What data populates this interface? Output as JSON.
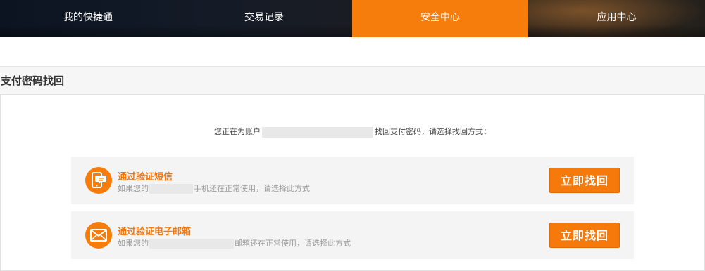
{
  "nav": {
    "tabs": [
      {
        "label": "我的快捷通"
      },
      {
        "label": "交易记录"
      },
      {
        "label": "安全中心",
        "active": true
      },
      {
        "label": "应用中心"
      }
    ]
  },
  "section": {
    "title": "支付密码找回"
  },
  "prompt": {
    "prefix": "您正在为账户",
    "suffix": "找回支付密码，请选择找回方式："
  },
  "options": [
    {
      "icon": "sms-phone-icon",
      "title": "通过验证短信",
      "desc_prefix": "如果您的",
      "desc_suffix": "手机还在正常使用，请选择此方式",
      "button": "立即找回"
    },
    {
      "icon": "envelope-icon",
      "title": "通过验证电子邮箱",
      "desc_prefix": "如果您的",
      "desc_suffix": "邮箱还在正常使用，请选择此方式",
      "button": "立即找回"
    }
  ],
  "colors": {
    "accent": "#f67c0c",
    "title_orange": "#f07610",
    "muted_text": "#999999"
  }
}
